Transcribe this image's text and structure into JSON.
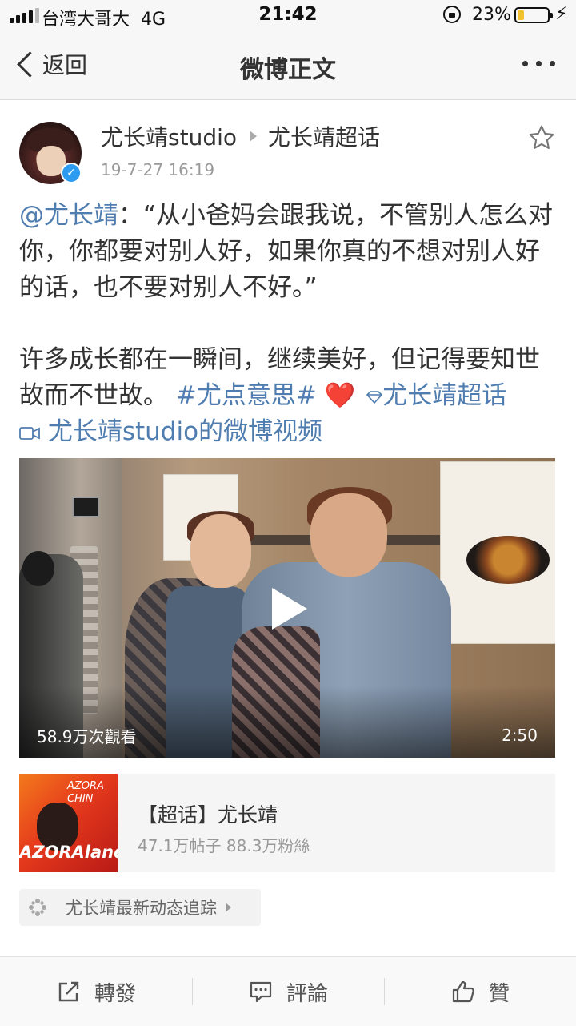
{
  "status_bar": {
    "carrier": "台湾大哥大",
    "network": "4G",
    "time": "21:42",
    "battery_percent": "23%",
    "battery_level": 0.23,
    "battery_color": "#f2c12e"
  },
  "nav": {
    "back_label": "返回",
    "title": "微博正文"
  },
  "post": {
    "author": "尤长靖studio",
    "topic": "尤长靖超话",
    "timestamp": "19-7-27 16:19",
    "mention": "@尤长靖",
    "quote": "：“从小爸妈会跟我说，不管别人怎么对你，你都要对别人好，如果你真的不想对别人好的话，也不要对别人不好。”",
    "para2_text": "许多成长都在一瞬间，继续美好，但记得要知世故而不世故。",
    "hashtag": "#尤点意思#",
    "emoji": "❤️",
    "supertopic_link": "尤长靖超话",
    "video_link": "尤长靖studio的微博视频",
    "link_color": "#507daf"
  },
  "video": {
    "views": "58.9万次觀看",
    "duration": "2:50"
  },
  "topic_card": {
    "title": "【超话】尤长靖",
    "stats": "47.1万帖子 88.3万粉絲",
    "cover_text_top": "AZORA CHIN",
    "cover_text_bottom": "AZORAland"
  },
  "tracking": {
    "label": "尤长靖最新动态追踪"
  },
  "actions": {
    "repost": "轉發",
    "comment": "評論",
    "like": "贊"
  },
  "icons": [
    "signal-icon",
    "lock-rotation-icon",
    "battery-icon",
    "charging-icon",
    "back-chevron-icon",
    "more-icon",
    "verified-icon",
    "star-icon",
    "diamond-icon",
    "video-camera-icon",
    "play-icon",
    "tracking-icon",
    "repost-icon",
    "comment-icon",
    "like-icon"
  ]
}
